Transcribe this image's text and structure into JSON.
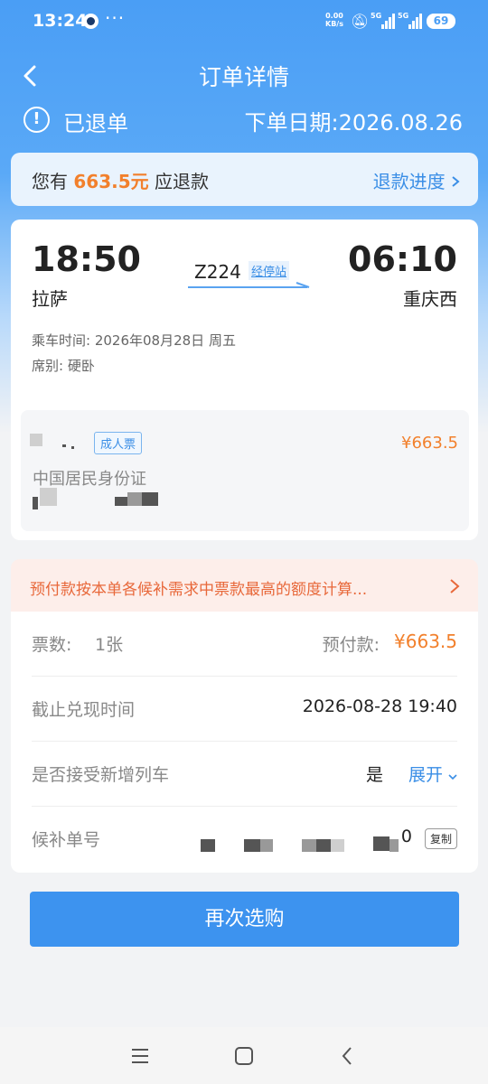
{
  "status_bar": {
    "time": "13:24",
    "dots": "···",
    "net_speed_value": "0.00",
    "net_speed_unit": "KB/s",
    "sim1": "5G",
    "sim2": "5G",
    "battery": "69"
  },
  "header": {
    "title": "订单详情",
    "order_status": "已退单",
    "order_date": "下单日期:2026.08.26"
  },
  "refund_banner": {
    "prefix": "您有",
    "amount": "663.5元",
    "suffix": "应退款",
    "progress_link": "退款进度"
  },
  "trip": {
    "departure_time": "18:50",
    "departure_station": "拉萨",
    "arrival_time": "06:10",
    "arrival_station": "重庆西",
    "train_number": "Z224",
    "stops_link": "经停站",
    "ride_time": "乘车时间: 2026年08月28日 周五",
    "seat_type": "席别: 硬卧"
  },
  "passenger": {
    "ticket_type": "成人票",
    "price": "¥663.5",
    "id_type": "中国居民身份证"
  },
  "notice": {
    "text": "预付款按本单各候补需求中票款最高的额度计算..."
  },
  "details": {
    "tickets_label": "票数:",
    "tickets_value": "1张",
    "prepay_label": "预付款:",
    "prepay_value": "¥663.5",
    "deadline_label": "截止兑现时间",
    "deadline_value": "2026-08-28 19:40",
    "accept_label": "是否接受新增列车",
    "accept_value": "是",
    "expand_label": "展开",
    "waitlist_label": "候补单号",
    "waitlist_tail": "0",
    "copy_label": "复制"
  },
  "actions": {
    "rebuy": "再次选购"
  },
  "colors": {
    "brand_blue": "#3d93ef",
    "accent_orange": "#f2802c",
    "notice_bg": "#fdeeea"
  },
  "icons": {
    "back": "back-arrow-icon",
    "status": "alert-circle-icon",
    "menu": "menu-icon",
    "home": "home-icon",
    "back_nav": "back-nav-icon"
  }
}
